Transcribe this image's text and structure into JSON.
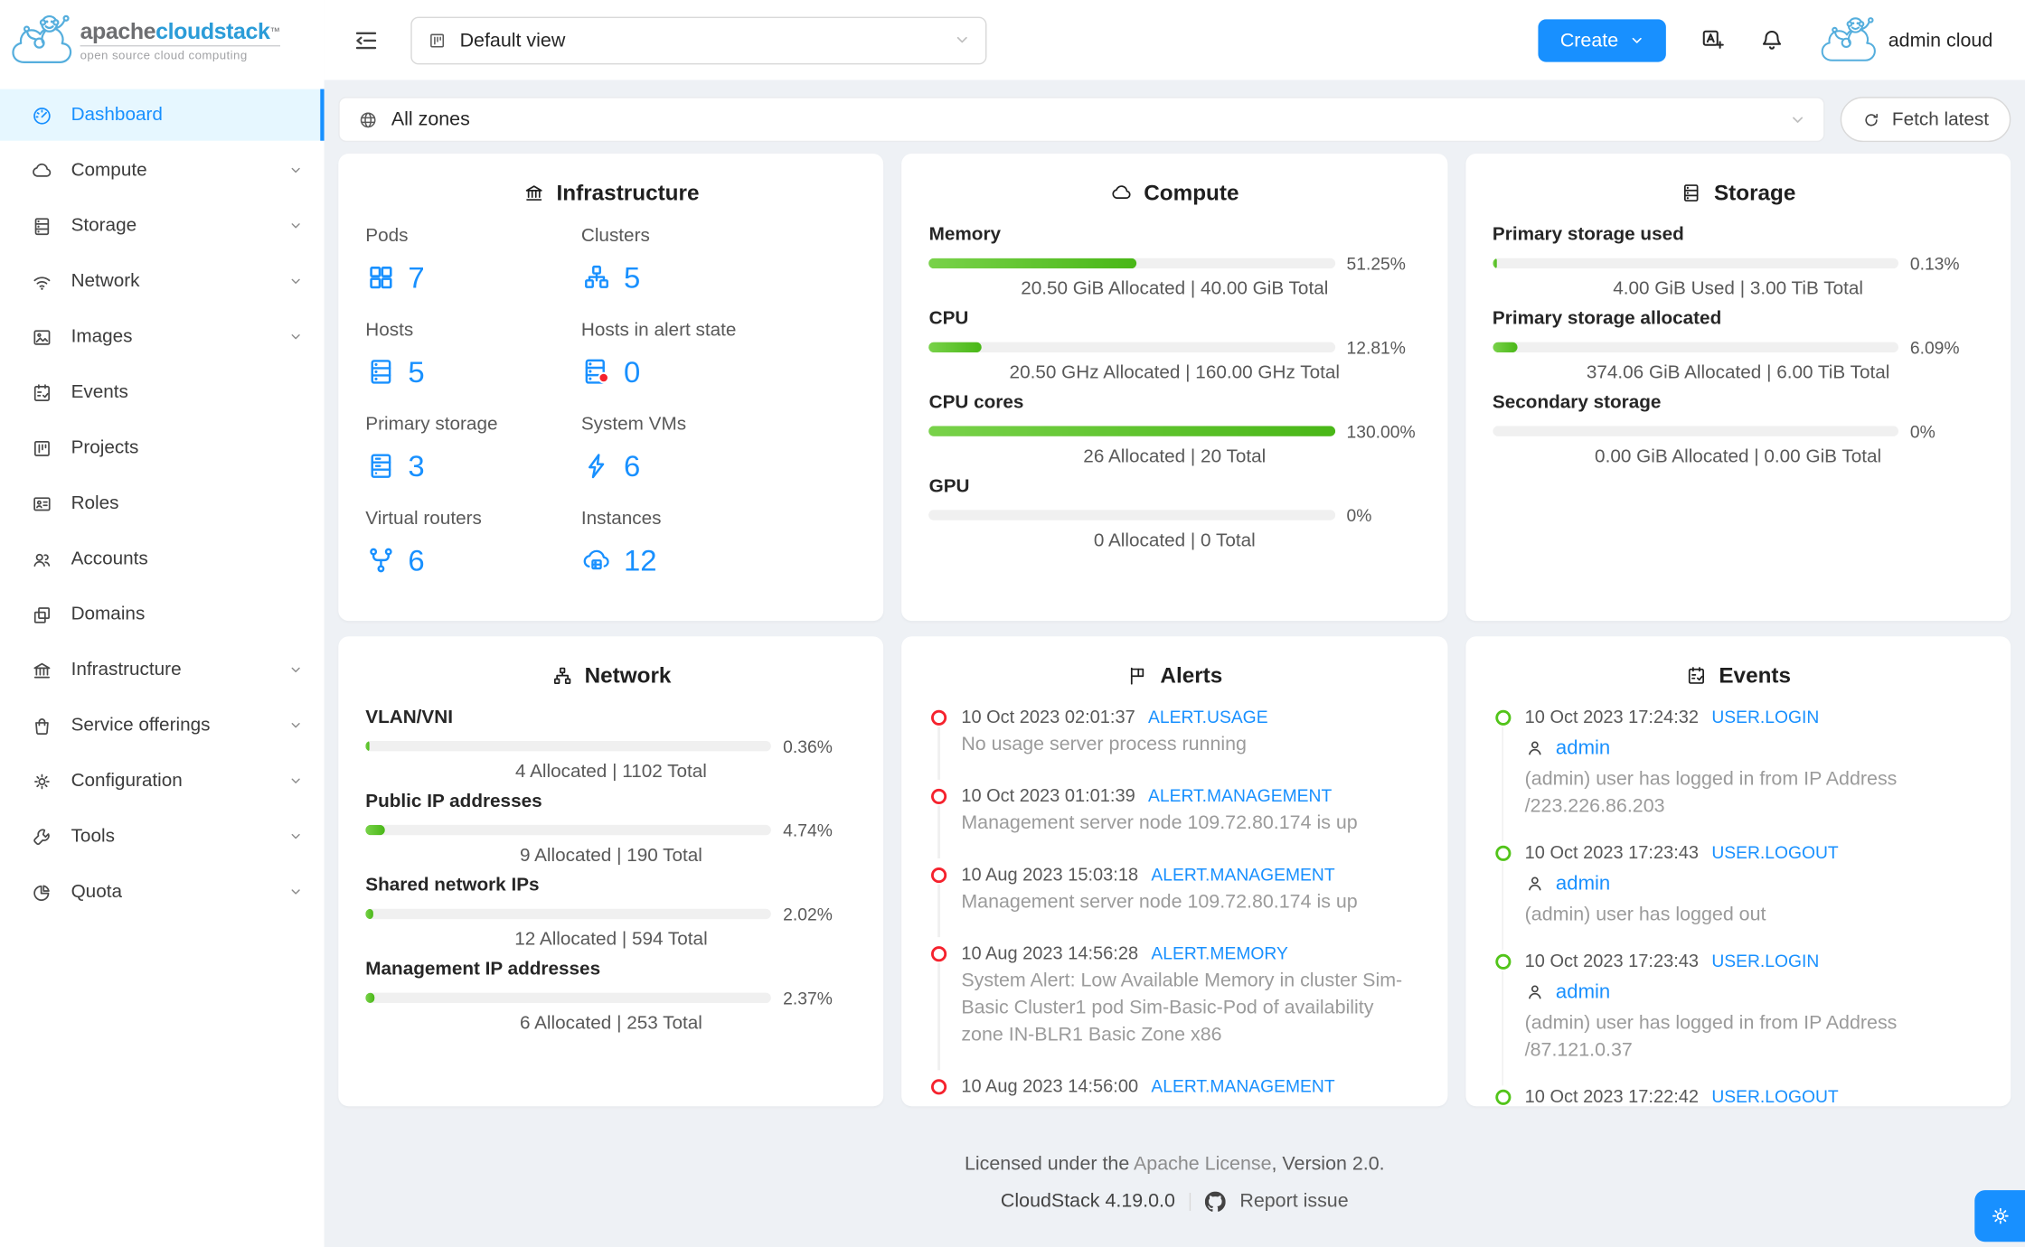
{
  "brand": {
    "name_prefix": "apache",
    "name_suffix": "cloudstack",
    "trademark": "TM",
    "tagline": "open source cloud computing"
  },
  "header": {
    "view_select": "Default view",
    "create_label": "Create",
    "user_name": "admin cloud"
  },
  "zonebar": {
    "zone_select": "All zones",
    "fetch_label": "Fetch latest"
  },
  "sidebar": {
    "items": [
      {
        "label": "Dashboard",
        "icon": "dashboard-icon",
        "selected": true
      },
      {
        "label": "Compute",
        "icon": "cloud-icon",
        "expandable": true
      },
      {
        "label": "Storage",
        "icon": "database-icon",
        "expandable": true
      },
      {
        "label": "Network",
        "icon": "wifi-icon",
        "expandable": true
      },
      {
        "label": "Images",
        "icon": "picture-icon",
        "expandable": true
      },
      {
        "label": "Events",
        "icon": "schedule-icon"
      },
      {
        "label": "Projects",
        "icon": "project-icon"
      },
      {
        "label": "Roles",
        "icon": "idcard-icon"
      },
      {
        "label": "Accounts",
        "icon": "team-icon"
      },
      {
        "label": "Domains",
        "icon": "block-icon"
      },
      {
        "label": "Infrastructure",
        "icon": "bank-icon",
        "expandable": true
      },
      {
        "label": "Service offerings",
        "icon": "shopping-icon",
        "expandable": true
      },
      {
        "label": "Configuration",
        "icon": "gear-icon",
        "expandable": true
      },
      {
        "label": "Tools",
        "icon": "wrench-icon",
        "expandable": true
      },
      {
        "label": "Quota",
        "icon": "pie-chart-icon",
        "expandable": true
      }
    ]
  },
  "infrastructure": {
    "title": "Infrastructure",
    "stats": [
      {
        "label": "Pods",
        "value": "7",
        "icon": "appstore-icon"
      },
      {
        "label": "Clusters",
        "value": "5",
        "icon": "cluster-icon"
      },
      {
        "label": "Hosts",
        "value": "5",
        "icon": "database-icon"
      },
      {
        "label": "Hosts in alert state",
        "value": "0",
        "icon": "database-alert-icon"
      },
      {
        "label": "Primary storage",
        "value": "3",
        "icon": "hdd-icon"
      },
      {
        "label": "System VMs",
        "value": "6",
        "icon": "thunderbolt-icon"
      },
      {
        "label": "Virtual routers",
        "value": "6",
        "icon": "fork-icon"
      },
      {
        "label": "Instances",
        "value": "12",
        "icon": "cloud-server-icon"
      }
    ]
  },
  "compute": {
    "title": "Compute",
    "meters": [
      {
        "label": "Memory",
        "percent": 51.25,
        "percent_label": "51.25%",
        "caption": "20.50 GiB Allocated | 40.00 GiB Total"
      },
      {
        "label": "CPU",
        "percent": 12.81,
        "percent_label": "12.81%",
        "caption": "20.50 GHz Allocated | 160.00 GHz Total"
      },
      {
        "label": "CPU cores",
        "percent": 130,
        "percent_label": "130.00%",
        "caption": "26 Allocated | 20 Total"
      },
      {
        "label": "GPU",
        "percent": 0,
        "percent_label": "0%",
        "caption": "0 Allocated | 0 Total"
      }
    ]
  },
  "storage": {
    "title": "Storage",
    "meters": [
      {
        "label": "Primary storage used",
        "percent": 0.13,
        "percent_label": "0.13%",
        "caption": "4.00 GiB Used | 3.00 TiB Total"
      },
      {
        "label": "Primary storage allocated",
        "percent": 6.09,
        "percent_label": "6.09%",
        "caption": "374.06 GiB Allocated | 6.00 TiB Total"
      },
      {
        "label": "Secondary storage",
        "percent": 0,
        "percent_label": "0%",
        "caption": "0.00 GiB Allocated | 0.00 GiB Total"
      }
    ]
  },
  "network": {
    "title": "Network",
    "meters": [
      {
        "label": "VLAN/VNI",
        "percent": 0.36,
        "percent_label": "0.36%",
        "caption": "4 Allocated | 1102 Total"
      },
      {
        "label": "Public IP addresses",
        "percent": 4.74,
        "percent_label": "4.74%",
        "caption": "9 Allocated | 190 Total"
      },
      {
        "label": "Shared network IPs",
        "percent": 2.02,
        "percent_label": "2.02%",
        "caption": "12 Allocated | 594 Total"
      },
      {
        "label": "Management IP addresses",
        "percent": 2.37,
        "percent_label": "2.37%",
        "caption": "6 Allocated | 253 Total"
      }
    ]
  },
  "alerts": {
    "title": "Alerts",
    "items": [
      {
        "time": "10 Oct 2023 02:01:37",
        "type": "ALERT.USAGE",
        "message": "No usage server process running"
      },
      {
        "time": "10 Oct 2023 01:01:39",
        "type": "ALERT.MANAGEMENT",
        "message": "Management server node 109.72.80.174 is up"
      },
      {
        "time": "10 Aug 2023 15:03:18",
        "type": "ALERT.MANAGEMENT",
        "message": "Management server node 109.72.80.174 is up"
      },
      {
        "time": "10 Aug 2023 14:56:28",
        "type": "ALERT.MEMORY",
        "message": "System Alert: Low Available Memory in cluster Sim-Basic Cluster1 pod Sim-Basic-Pod of availability zone IN-BLR1 Basic Zone x86"
      },
      {
        "time": "10 Aug 2023 14:56:00",
        "type": "ALERT.MANAGEMENT",
        "message": ""
      }
    ]
  },
  "events": {
    "title": "Events",
    "items": [
      {
        "time": "10 Oct 2023 17:24:32",
        "type": "USER.LOGIN",
        "user": "admin",
        "message": "(admin) user has logged in from IP Address /223.226.86.203"
      },
      {
        "time": "10 Oct 2023 17:23:43",
        "type": "USER.LOGOUT",
        "user": "admin",
        "message": "(admin) user has logged out"
      },
      {
        "time": "10 Oct 2023 17:23:43",
        "type": "USER.LOGIN",
        "user": "admin",
        "message": "(admin) user has logged in from IP Address /87.121.0.37"
      },
      {
        "time": "10 Oct 2023 17:22:42",
        "type": "USER.LOGOUT",
        "user": "",
        "message": ""
      }
    ]
  },
  "footer": {
    "license_prefix": "Licensed under the ",
    "license_link": "Apache License",
    "license_suffix": ", Version 2.0.",
    "version": "CloudStack 4.19.0.0",
    "report_issue": "Report issue"
  },
  "colors": {
    "primary": "#1890ff",
    "selected_menu_bg": "#e6f7ff",
    "bar_gradient_from": "#79d24a",
    "bar_gradient_to": "#49b717",
    "alert_red": "#f5222d",
    "event_green": "#52c41a",
    "content_bg": "#eef1f5"
  }
}
